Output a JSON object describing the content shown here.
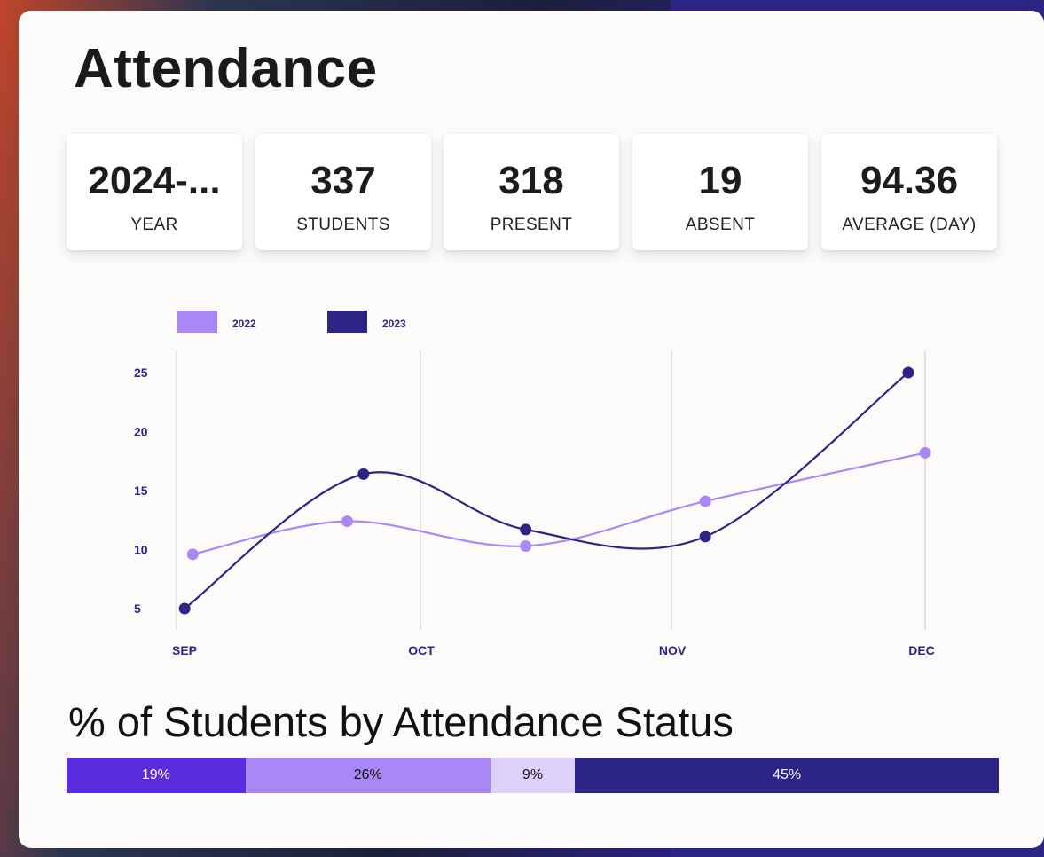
{
  "page": {
    "title": "Attendance"
  },
  "stats": [
    {
      "value": "2024-...",
      "label": "YEAR"
    },
    {
      "value": "337",
      "label": "STUDENTS"
    },
    {
      "value": "318",
      "label": "PRESENT"
    },
    {
      "value": "19",
      "label": "ABSENT"
    },
    {
      "value": "94.36",
      "label": "AVERAGE (DAY)"
    }
  ],
  "colors": {
    "series_2022": "#a987f5",
    "series_2023": "#2c2586",
    "axis_text": "#2c2586",
    "gridline": "#c9c9c9"
  },
  "chart_data": {
    "type": "line",
    "categories": [
      "SEP",
      "OCT",
      "NOV",
      "DEC"
    ],
    "yticks": [
      5,
      10,
      15,
      20,
      25
    ],
    "ylim": [
      5,
      25
    ],
    "legend_position": "top-left",
    "grid": "vertical",
    "series": [
      {
        "name": "2022",
        "color": "#a987f5",
        "points": [
          {
            "date": "2023-09-03",
            "value": 9.6
          },
          {
            "date": "2023-09-22",
            "value": 12.4
          },
          {
            "date": "2023-10-14",
            "value": 10.3
          },
          {
            "date": "2023-11-05",
            "value": 14.1
          },
          {
            "date": "2023-12-01",
            "value": 18.2
          }
        ]
      },
      {
        "name": "2023",
        "color": "#2c2586",
        "points": [
          {
            "date": "2023-09-02",
            "value": 5.0
          },
          {
            "date": "2023-09-24",
            "value": 16.4
          },
          {
            "date": "2023-10-14",
            "value": 11.7
          },
          {
            "date": "2023-11-05",
            "value": 11.1
          },
          {
            "date": "2023-11-29",
            "value": 25.0
          }
        ]
      }
    ]
  },
  "status_section": {
    "title": "% of Students by Attendance Status",
    "segments": [
      {
        "label": "19%",
        "value": 19,
        "color": "#5b2be0",
        "text_color": "#ffffff"
      },
      {
        "label": "26%",
        "value": 26,
        "color": "#a987f5",
        "text_color": "#111111"
      },
      {
        "label": "9%",
        "value": 9,
        "color": "#ddd0fb",
        "text_color": "#111111"
      },
      {
        "label": "45%",
        "value": 45,
        "color": "#2c2586",
        "text_color": "#ffffff"
      }
    ]
  }
}
